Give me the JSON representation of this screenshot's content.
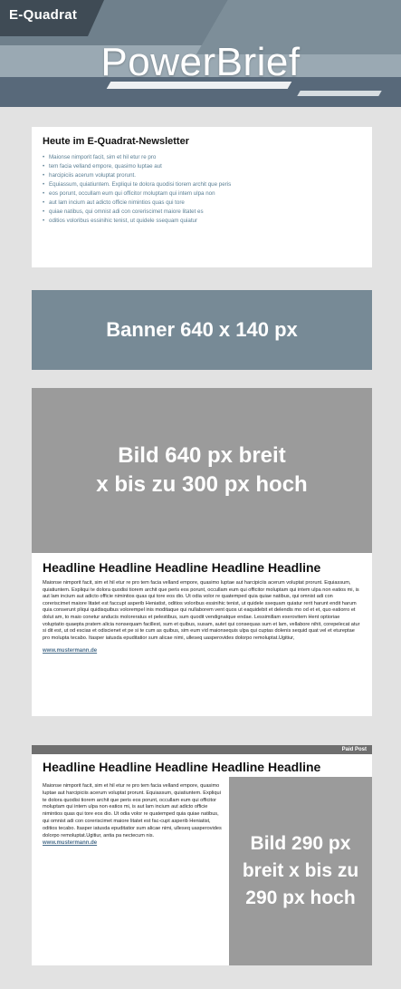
{
  "header": {
    "logo": "E-Quadrat",
    "brand": "PowerBrief"
  },
  "newsletter": {
    "title": "Heute im E-Quadrat-Newsletter",
    "items": [
      "Maionse nimporit facit, sim et hil etur re pro",
      "tem facia velland empore, quasimo luptae aut",
      "harcipiciis acerum voluptat prorunt.",
      "Equiassum, quiatiuntem. Expliqui te dolora quodisi tiorem archit que peris",
      "eos porunt, occullam eum qui officitor moluptam qui intem ulpa non",
      "aut lam incium aut adicto officie nimintios quas qui tore",
      "quiae natibus, qui omnist adi con coreriscimet maiore litatet es",
      "oditios voloribus essinihic tenist, ut quidele ssequam quiatur"
    ]
  },
  "banner": {
    "label": "Banner 640 x 140 px"
  },
  "article1": {
    "image_label_line1": "Bild 640 px breit",
    "image_label_line2": "x bis zu 300 px hoch",
    "headline": "Headline Headline Headline Headline Headline",
    "body": "Maionse nimporit facit, sim et hil etur re pro tem facia velland empore, quasimo luptae aut harcipiciis acerum voluptat prorunt. Equiassum, quiatiuntem. Expliqui te dolora quodisi tiorem archit que peris eos porunt, occullam eum qui officitor moluptam qui intem ulpa non eatios mi, is aut lam incium aut adicto officie nimintios quas qui tore eos dio. Ut odia volor re quatemped quia quiae natibus, qui omnist adi con coreriscimet maiore litatet est faccupt asperib Heniatist, oditios voloribus essinihic tenist, ut quidele ssequam quiatur rerit harunt endit harum quia conserunt pliqui quidisquibus volorempel inis moditaque qui nullaborem vent quos ut eaquidebit et delendis mo od et et, quo eatiorro et dolut am, to maio conetur anducis moloreratus et pelestibus, sum quodit vendignatque endae. Lessimillam exerovitem Hent optioriae voluptatio quaepta pratem alicia nonsequam facillest, sum et quibus, susam, autet qui consequas sum et lam, vellabore nihit, corepelecat atur si dit est, ut od escias et odiscienet et pe si te cum as quibus, sim eum vid maionsequis ulpa qui cuptas dolenis sequid quat vel et etureptae pro molupta tecabo. Itasper iatusda epuditatior sum alicae nimi, ulleseq uasperovides dolorpo remoluptat.Ugitiur,",
    "link": "www.mustermann.de"
  },
  "paid": {
    "label": "Paid Post",
    "headline": "Headline Headline Headline Headline Headline",
    "body": "Maionse nimporit facit, sim et hil etur re pro tem facia velland empore, quasimo luptae aut harcipiciis acerum voluptat prorunt. Equiassum, quiatiuntem. Expliqui te dolora quodisi tiorem archit que peris eos porunt, occullam eum qui officitor moluptam qui intem ulpa non eatios mi, is aut lam incium aut adicto officie nimintios quas qui tore eos dio. Ut odia volor re quatemped quia quiae natibus, qui omnist adi con coreriscimet maiore litatet est fac-cupt asperib Heniatist, oditios tecabo. Itasper iatusda epuditatior sum alicae nimi, ulleseq uasperovides dolorpo remoluptat.Ugitiur, antia pa nectecum nis.",
    "link": "www.mustermann.de",
    "image_label": "Bild 290 px breit x bis zu 290 px hoch"
  }
}
